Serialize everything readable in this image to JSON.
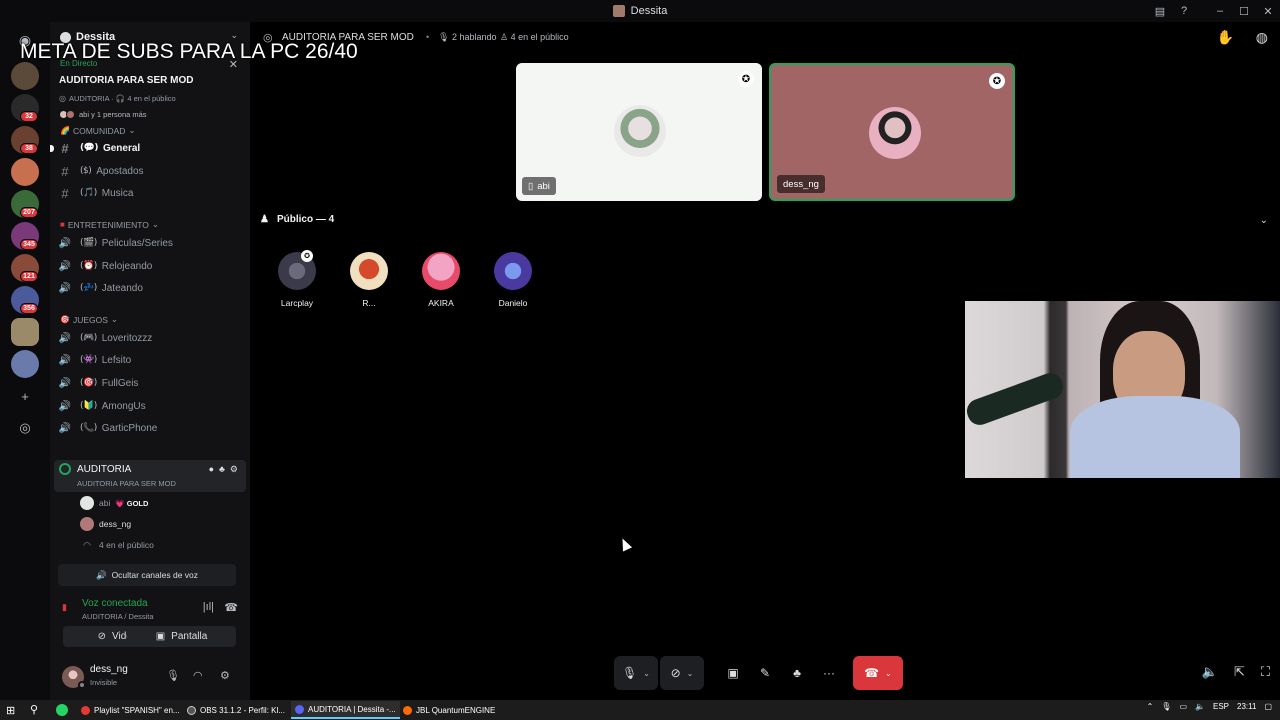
{
  "window": {
    "title": "Dessita"
  },
  "overlay": {
    "text": "META DE SUBS PARA LA PC 26/40"
  },
  "rail": {
    "badges": [
      "32",
      "38",
      "207",
      "345",
      "121",
      "356"
    ]
  },
  "server": {
    "name": "Dessita",
    "live_label": "En Directo",
    "stage_title": "AUDITORIA PARA SER MOD",
    "stage_meta": "AUDITORIA · 🎧 4 en el público",
    "people_text": "abi y 1 persona más"
  },
  "channels": {
    "cat1": "COMUNIDAD",
    "general": {
      "tag": "(💬)",
      "name": "General"
    },
    "apostados": {
      "tag": "($)",
      "name": "Apostados"
    },
    "musica": {
      "tag": "(🎵)",
      "name": "Musica"
    },
    "cat2": "ENTRETENIMIENTO",
    "peliculas": {
      "tag": "(🎬)",
      "name": "Peliculas/Series"
    },
    "relojeando": {
      "tag": "(⏰)",
      "name": "Relojeando"
    },
    "jateando": {
      "tag": "(💤)",
      "name": "Jateando"
    },
    "cat3": "JUEGOS",
    "loveritozzz": {
      "tag": "(🎮)",
      "name": "Loveritozzz"
    },
    "lefsito": {
      "tag": "(👾)",
      "name": "Lefsito"
    },
    "fullgeis": {
      "tag": "(🎯)",
      "name": "FullGeis"
    },
    "amongus": {
      "tag": "(🔰)",
      "name": "AmongUs"
    },
    "garticphone": {
      "tag": "(📞)",
      "name": "GarticPhone"
    }
  },
  "voice_channel": {
    "name": "AUDITORIA",
    "topic": "AUDITORIA PARA SER MOD",
    "users": [
      {
        "name": "abi",
        "badge": "💗 GOLD"
      },
      {
        "name": "dess_ng"
      }
    ],
    "audience": "4 en el público"
  },
  "hide_voice_label": "Ocultar canales de voz",
  "voice_connected": {
    "status": "Voz conectada",
    "location": "AUDITORIA / Dessita",
    "video_label": "Video",
    "screen_label": "Pantalla"
  },
  "user": {
    "name": "dess_ng",
    "status": "Invisible"
  },
  "topbar": {
    "stage_name": "AUDITORIA PARA SER MOD",
    "speaking": "2 hablando",
    "audience": "4 en el público"
  },
  "speakers": [
    {
      "name": "abi",
      "bg": "#f4f6f4"
    },
    {
      "name": "dess_ng",
      "bg": "#a16565"
    }
  ],
  "audience_section": {
    "title": "Público — 4",
    "members": [
      {
        "name": "Larcplay"
      },
      {
        "name": "R..."
      },
      {
        "name": "AKIRA"
      },
      {
        "name": "Danielo"
      }
    ]
  },
  "colors": {
    "accent_green": "#23a55a",
    "danger_red": "#da373c",
    "sidebar_bg": "#121214"
  },
  "taskbar": {
    "items": [
      "Playlist \"SPANISH\" en...",
      "OBS 31.1.2 - Perfil: Kl...",
      "AUDITORIA | Dessita -...",
      "JBL QuantumENGINE"
    ],
    "lang": "ESP",
    "time": "23:11"
  }
}
